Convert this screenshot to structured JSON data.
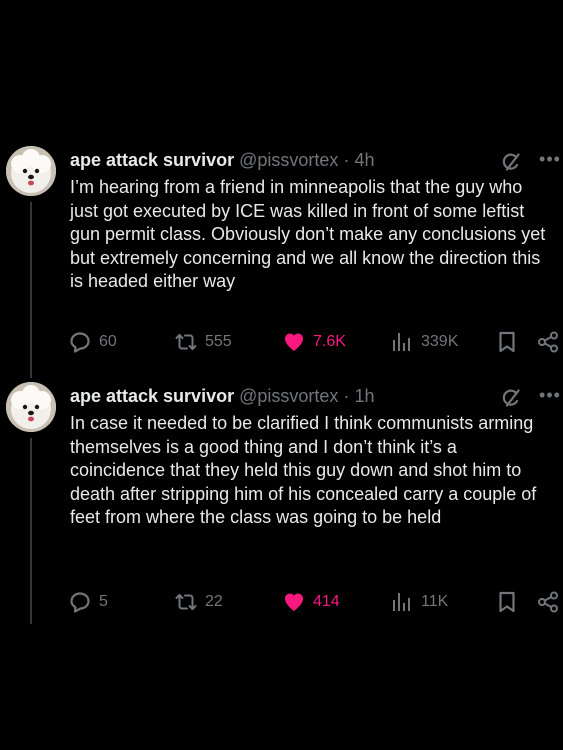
{
  "tweets": [
    {
      "author_name": "ape attack survivor",
      "handle": "@pissvortex",
      "separator": "·",
      "time": "4h",
      "text": "I’m hearing from a friend in minneapolis that the guy who just got executed by ICE was killed in front of some leftist gun permit class. Obviously don’t make any conclusions yet but extremely concerning and we all know the direction this is headed either way",
      "replies": "60",
      "reposts": "555",
      "likes": "7.6K",
      "views": "339K",
      "liked": true
    },
    {
      "author_name": "ape attack survivor",
      "handle": "@pissvortex",
      "separator": "·",
      "time": "1h",
      "text": "In case it needed to be clarified I think communists arming themselves is a good thing and I don’t think it’s a coincidence that they held this guy down and shot him to death after stripping him of his concealed carry a couple of feet from where the class was going to be held",
      "replies": "5",
      "reposts": "22",
      "likes": "414",
      "views": "11K",
      "liked": true
    }
  ],
  "icons": {
    "reply": "speech-bubble-icon",
    "repost": "repost-arrows-icon",
    "like": "heart-icon",
    "views": "bar-chart-icon",
    "bookmark": "bookmark-icon",
    "share": "share-icon",
    "grok": "grok-icon",
    "more": "more-dots-icon"
  },
  "colors": {
    "background": "#000000",
    "text": "#e7e9ea",
    "muted": "#71767b",
    "like": "#f91880",
    "thread_line": "#333639"
  }
}
